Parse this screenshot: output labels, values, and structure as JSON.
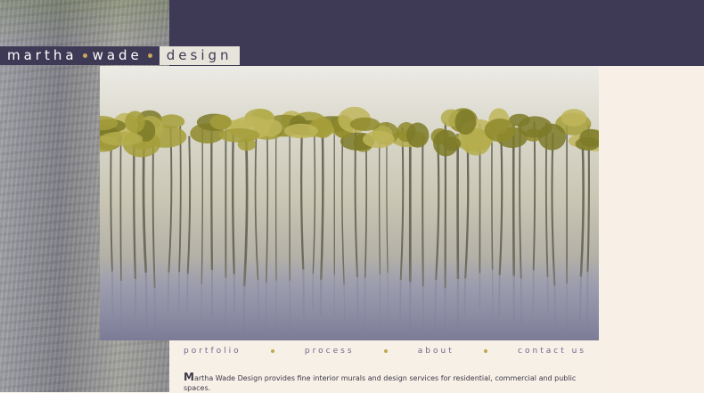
{
  "brand": {
    "name_part1": "martha",
    "name_part2": "wade",
    "name_part3": "design"
  },
  "hero": {
    "image_name": "tree-mural-painting",
    "tree_count": 44
  },
  "nav": {
    "items": [
      "portfolio",
      "process",
      "about",
      "contact us"
    ]
  },
  "intro": {
    "initial": "M",
    "text": "artha Wade Design provides fine interior murals and design services for residential, commercial and public spaces."
  },
  "colors": {
    "band": "#3e3a55",
    "accent_dot": "#c2a753",
    "nav_text": "#6e6790",
    "cream": "#f7f0e7"
  }
}
